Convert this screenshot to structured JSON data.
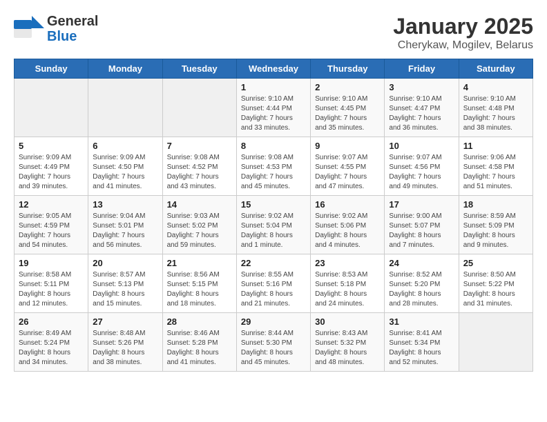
{
  "header": {
    "logo_line1": "General",
    "logo_line2": "Blue",
    "title": "January 2025",
    "subtitle": "Cherykaw, Mogilev, Belarus"
  },
  "weekdays": [
    "Sunday",
    "Monday",
    "Tuesday",
    "Wednesday",
    "Thursday",
    "Friday",
    "Saturday"
  ],
  "weeks": [
    [
      {
        "day": "",
        "info": ""
      },
      {
        "day": "",
        "info": ""
      },
      {
        "day": "",
        "info": ""
      },
      {
        "day": "1",
        "info": "Sunrise: 9:10 AM\nSunset: 4:44 PM\nDaylight: 7 hours and 33 minutes."
      },
      {
        "day": "2",
        "info": "Sunrise: 9:10 AM\nSunset: 4:45 PM\nDaylight: 7 hours and 35 minutes."
      },
      {
        "day": "3",
        "info": "Sunrise: 9:10 AM\nSunset: 4:47 PM\nDaylight: 7 hours and 36 minutes."
      },
      {
        "day": "4",
        "info": "Sunrise: 9:10 AM\nSunset: 4:48 PM\nDaylight: 7 hours and 38 minutes."
      }
    ],
    [
      {
        "day": "5",
        "info": "Sunrise: 9:09 AM\nSunset: 4:49 PM\nDaylight: 7 hours and 39 minutes."
      },
      {
        "day": "6",
        "info": "Sunrise: 9:09 AM\nSunset: 4:50 PM\nDaylight: 7 hours and 41 minutes."
      },
      {
        "day": "7",
        "info": "Sunrise: 9:08 AM\nSunset: 4:52 PM\nDaylight: 7 hours and 43 minutes."
      },
      {
        "day": "8",
        "info": "Sunrise: 9:08 AM\nSunset: 4:53 PM\nDaylight: 7 hours and 45 minutes."
      },
      {
        "day": "9",
        "info": "Sunrise: 9:07 AM\nSunset: 4:55 PM\nDaylight: 7 hours and 47 minutes."
      },
      {
        "day": "10",
        "info": "Sunrise: 9:07 AM\nSunset: 4:56 PM\nDaylight: 7 hours and 49 minutes."
      },
      {
        "day": "11",
        "info": "Sunrise: 9:06 AM\nSunset: 4:58 PM\nDaylight: 7 hours and 51 minutes."
      }
    ],
    [
      {
        "day": "12",
        "info": "Sunrise: 9:05 AM\nSunset: 4:59 PM\nDaylight: 7 hours and 54 minutes."
      },
      {
        "day": "13",
        "info": "Sunrise: 9:04 AM\nSunset: 5:01 PM\nDaylight: 7 hours and 56 minutes."
      },
      {
        "day": "14",
        "info": "Sunrise: 9:03 AM\nSunset: 5:02 PM\nDaylight: 7 hours and 59 minutes."
      },
      {
        "day": "15",
        "info": "Sunrise: 9:02 AM\nSunset: 5:04 PM\nDaylight: 8 hours and 1 minute."
      },
      {
        "day": "16",
        "info": "Sunrise: 9:02 AM\nSunset: 5:06 PM\nDaylight: 8 hours and 4 minutes."
      },
      {
        "day": "17",
        "info": "Sunrise: 9:00 AM\nSunset: 5:07 PM\nDaylight: 8 hours and 7 minutes."
      },
      {
        "day": "18",
        "info": "Sunrise: 8:59 AM\nSunset: 5:09 PM\nDaylight: 8 hours and 9 minutes."
      }
    ],
    [
      {
        "day": "19",
        "info": "Sunrise: 8:58 AM\nSunset: 5:11 PM\nDaylight: 8 hours and 12 minutes."
      },
      {
        "day": "20",
        "info": "Sunrise: 8:57 AM\nSunset: 5:13 PM\nDaylight: 8 hours and 15 minutes."
      },
      {
        "day": "21",
        "info": "Sunrise: 8:56 AM\nSunset: 5:15 PM\nDaylight: 8 hours and 18 minutes."
      },
      {
        "day": "22",
        "info": "Sunrise: 8:55 AM\nSunset: 5:16 PM\nDaylight: 8 hours and 21 minutes."
      },
      {
        "day": "23",
        "info": "Sunrise: 8:53 AM\nSunset: 5:18 PM\nDaylight: 8 hours and 24 minutes."
      },
      {
        "day": "24",
        "info": "Sunrise: 8:52 AM\nSunset: 5:20 PM\nDaylight: 8 hours and 28 minutes."
      },
      {
        "day": "25",
        "info": "Sunrise: 8:50 AM\nSunset: 5:22 PM\nDaylight: 8 hours and 31 minutes."
      }
    ],
    [
      {
        "day": "26",
        "info": "Sunrise: 8:49 AM\nSunset: 5:24 PM\nDaylight: 8 hours and 34 minutes."
      },
      {
        "day": "27",
        "info": "Sunrise: 8:48 AM\nSunset: 5:26 PM\nDaylight: 8 hours and 38 minutes."
      },
      {
        "day": "28",
        "info": "Sunrise: 8:46 AM\nSunset: 5:28 PM\nDaylight: 8 hours and 41 minutes."
      },
      {
        "day": "29",
        "info": "Sunrise: 8:44 AM\nSunset: 5:30 PM\nDaylight: 8 hours and 45 minutes."
      },
      {
        "day": "30",
        "info": "Sunrise: 8:43 AM\nSunset: 5:32 PM\nDaylight: 8 hours and 48 minutes."
      },
      {
        "day": "31",
        "info": "Sunrise: 8:41 AM\nSunset: 5:34 PM\nDaylight: 8 hours and 52 minutes."
      },
      {
        "day": "",
        "info": ""
      }
    ]
  ]
}
